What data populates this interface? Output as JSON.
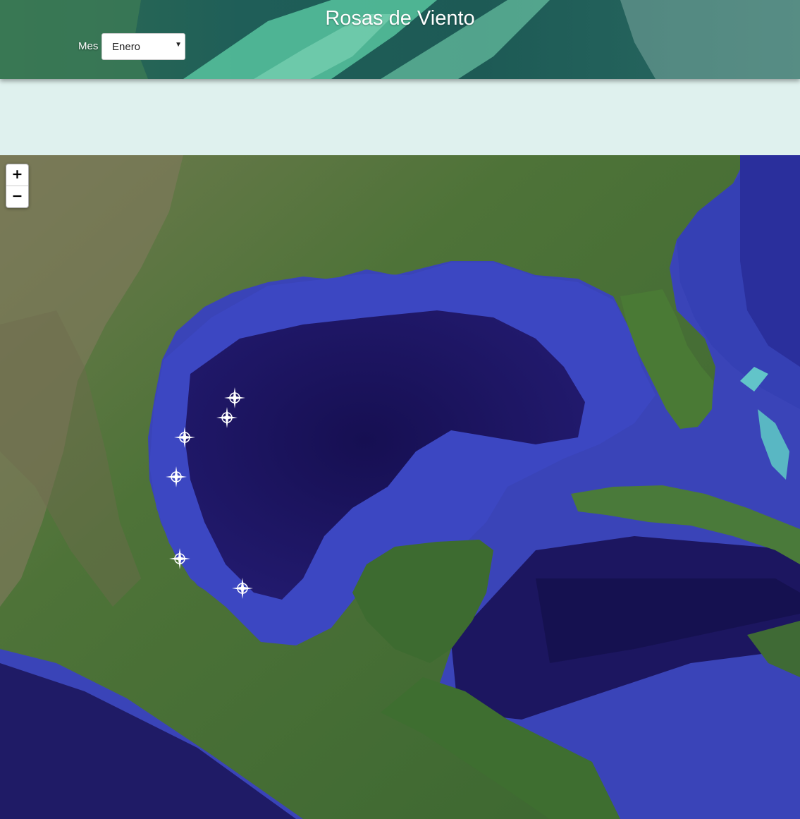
{
  "header": {
    "title": "Rosas de Viento",
    "month_label": "Mes",
    "month_selected": "Enero"
  },
  "map": {
    "zoom_in_label": "+",
    "zoom_out_label": "−",
    "station_count": 6,
    "colors": {
      "deep_water": "#1b1560",
      "shelf_water": "#3b46c0",
      "land": "#3f6d35",
      "panel": "#dff1ee"
    }
  }
}
